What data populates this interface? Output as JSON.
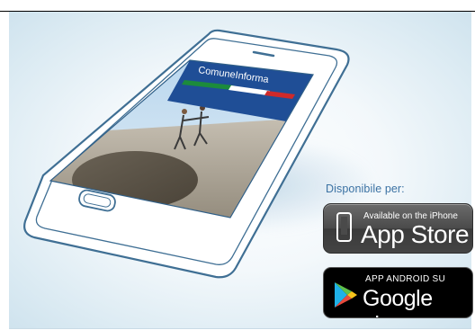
{
  "header": {
    "dots": ""
  },
  "app": {
    "brand_title": "ComuneInforma",
    "flag_colors": [
      "#1c8b3c",
      "#ffffff",
      "#cf2a2a"
    ],
    "header_color": "#1f4e96"
  },
  "download": {
    "label": "Disponibile per:",
    "app_store": {
      "small": "Available on the iPhone",
      "big": "App Store"
    },
    "google_play": {
      "small": "APP ANDROID SU",
      "big": "Google play"
    }
  },
  "colors": {
    "accent": "#3b72a3",
    "phone_outline": "#3f6f94"
  }
}
